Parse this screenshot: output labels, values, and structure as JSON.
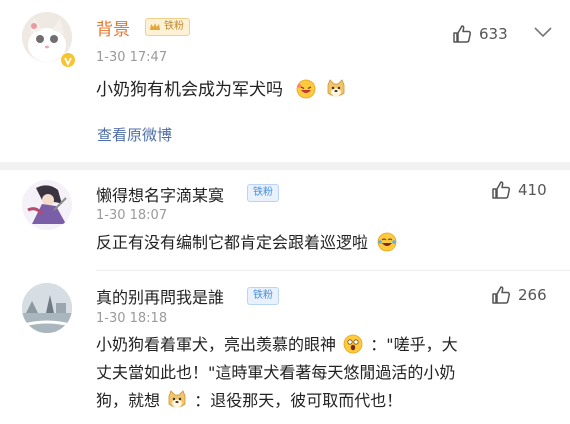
{
  "posts": [
    {
      "author": "背景",
      "badge": "铁粉",
      "time": "1-30 17:47",
      "text": "小奶狗有机会成为军犬吗",
      "likes": "633",
      "view_original": "查看原微博",
      "emoji": [
        "laughing-emoji",
        "doge-emoji"
      ]
    },
    {
      "author": "懒得想名字滴某寞",
      "badge": "铁粉",
      "time": "1-30 18:07",
      "text": "反正有没有编制它都肯定会跟着巡逻啦",
      "likes": "410",
      "emoji": [
        "laughing-tears-emoji"
      ]
    },
    {
      "author": "真的别再問我是誰",
      "badge": "铁粉",
      "time": "1-30 18:18",
      "likes": "266",
      "text_lines": [
        "小奶狗看着軍犬，亮出羡慕的眼神",
        "：\"嗟乎，大",
        "丈夫當如此也！\"這時軍犬看著每天悠閒過活的小奶",
        "狗，就想",
        "：退役那天，彼可取而代也！"
      ],
      "emoji": [
        "awe-emoji",
        "doge-emoji"
      ]
    }
  ],
  "colors": {
    "vip_name": "#e8762d",
    "link": "#4e6ea8",
    "meta": "#9a9a9a",
    "fan_badge": "#4c8fdc"
  }
}
